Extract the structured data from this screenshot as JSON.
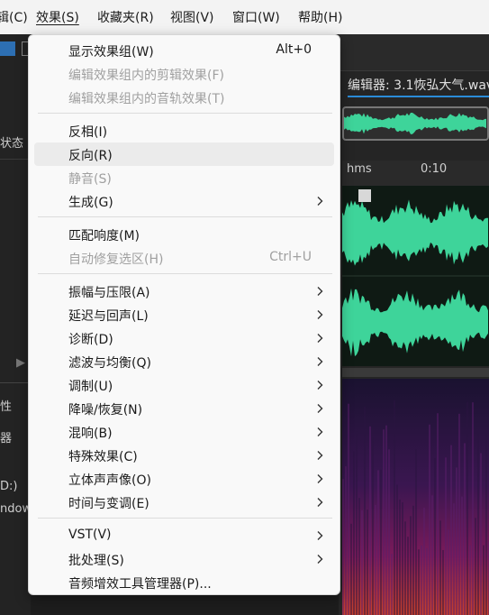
{
  "menubar": {
    "items": [
      "辑(C)",
      "效果(S)",
      "收藏夹(R)",
      "视图(V)",
      "窗口(W)",
      "帮助(H)"
    ]
  },
  "left_panel": {
    "state_label": "状态",
    "property_label": "性",
    "device_label": "器",
    "d_label": "D:)",
    "windows_label": "ndows"
  },
  "editor": {
    "title": "编辑器: 3.1恢弘大气.wav",
    "ruler": {
      "hms": "hms",
      "t10": "0:10"
    }
  },
  "effects_menu": {
    "items": [
      {
        "label": "显示效果组(W)",
        "shortcut": "Alt+0",
        "disabled": false,
        "submenu": false
      },
      {
        "label": "编辑效果组内的剪辑效果(F)",
        "shortcut": "",
        "disabled": true,
        "submenu": false
      },
      {
        "label": "编辑效果组内的音轨效果(T)",
        "shortcut": "",
        "disabled": true,
        "submenu": false
      },
      {
        "label": "反相(I)",
        "shortcut": "",
        "disabled": false,
        "submenu": false
      },
      {
        "label": "反向(R)",
        "shortcut": "",
        "disabled": false,
        "submenu": false,
        "hover": true
      },
      {
        "label": "静音(S)",
        "shortcut": "",
        "disabled": true,
        "submenu": false
      },
      {
        "label": "生成(G)",
        "shortcut": "",
        "disabled": false,
        "submenu": true
      },
      {
        "label": "匹配响度(M)",
        "shortcut": "",
        "disabled": false,
        "submenu": false
      },
      {
        "label": "自动修复选区(H)",
        "shortcut": "Ctrl+U",
        "disabled": true,
        "submenu": false
      },
      {
        "label": "振幅与压限(A)",
        "shortcut": "",
        "disabled": false,
        "submenu": true
      },
      {
        "label": "延迟与回声(L)",
        "shortcut": "",
        "disabled": false,
        "submenu": true
      },
      {
        "label": "诊断(D)",
        "shortcut": "",
        "disabled": false,
        "submenu": true
      },
      {
        "label": "滤波与均衡(Q)",
        "shortcut": "",
        "disabled": false,
        "submenu": true
      },
      {
        "label": "调制(U)",
        "shortcut": "",
        "disabled": false,
        "submenu": true
      },
      {
        "label": "降噪/恢复(N)",
        "shortcut": "",
        "disabled": false,
        "submenu": true
      },
      {
        "label": "混响(B)",
        "shortcut": "",
        "disabled": false,
        "submenu": true
      },
      {
        "label": "特殊效果(C)",
        "shortcut": "",
        "disabled": false,
        "submenu": true
      },
      {
        "label": "立体声声像(O)",
        "shortcut": "",
        "disabled": false,
        "submenu": true
      },
      {
        "label": "时间与变调(E)",
        "shortcut": "",
        "disabled": false,
        "submenu": true
      },
      {
        "label": "VST(V)",
        "shortcut": "",
        "disabled": false,
        "submenu": true
      },
      {
        "label": "批处理(S)",
        "shortcut": "",
        "disabled": false,
        "submenu": true
      },
      {
        "label": "音频增效工具管理器(P)...",
        "shortcut": "",
        "disabled": false,
        "submenu": false
      }
    ]
  },
  "colors": {
    "waveform": "#3ed49a",
    "accent": "#2a8bd8"
  }
}
